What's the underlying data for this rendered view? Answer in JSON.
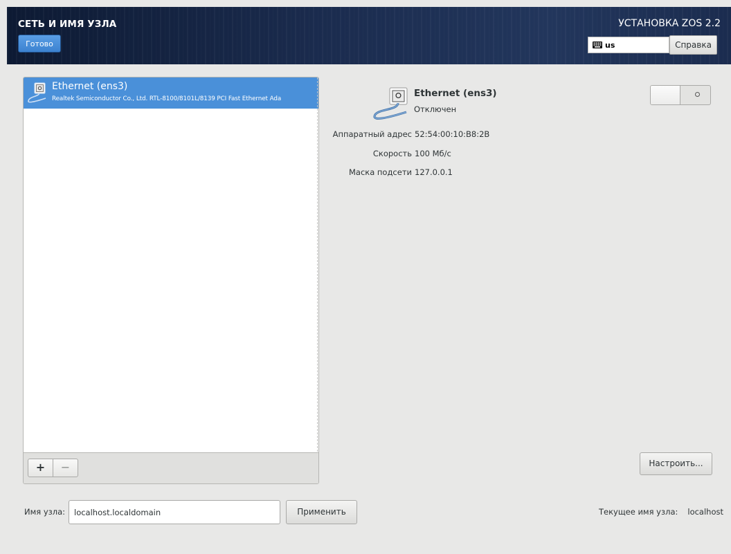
{
  "header": {
    "spoke_title": "СЕТЬ И ИМЯ УЗЛА",
    "done_label": "Готово",
    "product_title": "УСТАНОВКА ZOS 2.2",
    "keyboard_layout": "us",
    "keyboard_icon": "keyboard-icon",
    "help_label": "Справка",
    "colors": {
      "header_bg": "#1b2c4f",
      "done_button": "#4a90d9"
    }
  },
  "device_list": {
    "items": [
      {
        "name": "Ethernet (ens3)",
        "description": "Realtek Semiconductor Co., Ltd. RTL-8100/8101L/8139 PCI Fast Ethernet Ada",
        "icon": "ethernet-cable-icon",
        "selected": true
      }
    ],
    "add_label": "+",
    "remove_label": "−",
    "selection_color": "#4a90d9"
  },
  "details": {
    "name": "Ethernet (ens3)",
    "status": "Отключен",
    "icon": "ethernet-cable-icon",
    "fields": [
      {
        "label": "Аппаратный адрес",
        "value": "52:54:00:10:B8:2B"
      },
      {
        "label": "Скорость",
        "value": "100 Мб/с"
      },
      {
        "label": "Маска подсети",
        "value": "127.0.0.1"
      }
    ],
    "switch_on": false,
    "configure_label": "Настроить..."
  },
  "hostname": {
    "label": "Имя узла:",
    "value": "localhost.localdomain",
    "apply_label": "Применить",
    "current_label": "Текущее имя узла:",
    "current_value": "localhost"
  }
}
